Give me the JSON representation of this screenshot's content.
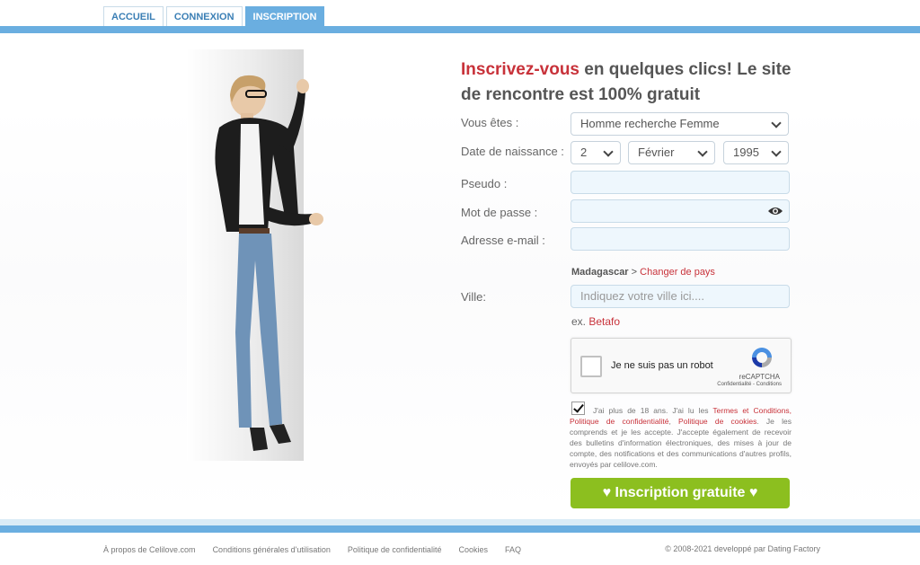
{
  "tabs": [
    {
      "label": "ACCUEIL"
    },
    {
      "label": "CONNEXION"
    },
    {
      "label": "INSCRIPTION"
    }
  ],
  "headline": {
    "accent": "Inscrivez-vous",
    "rest": " en quelques clics! Le site de rencontre est 100% gratuit"
  },
  "form": {
    "you_are_label": "Vous êtes :",
    "you_are_value": "Homme recherche Femme",
    "birth_label": "Date de naissance :",
    "birth_day": "2",
    "birth_month": "Février",
    "birth_year": "1995",
    "pseudo_label": "Pseudo :",
    "password_label": "Mot de passe :",
    "email_label": "Adresse e-mail :",
    "country": "Madagascar",
    "country_separator": ">",
    "change_country": "Changer de pays",
    "city_label": "Ville:",
    "city_placeholder": "Indiquez votre ville ici....",
    "example_prefix": "ex.",
    "example_city": "Betafo",
    "captcha_text": "Je ne suis pas un robot",
    "captcha_brand": "reCAPTCHA",
    "captcha_terms": "Confidentialité - Conditions",
    "legal_1": "J'ai plus de 18 ans. J'ai lu les ",
    "legal_link1": "Termes et Conditions, Politique de confidentialité",
    "legal_2": ", ",
    "legal_link2": "Politique de cookies",
    "legal_3": ". Je les comprends et je les accepte. J'accepte également de recevoir des bulletins d'information électroniques, des mises à jour de compte, des notifications et des communications d'autres profils, envoyés par celilove.com.",
    "submit_label": "♥ Inscription gratuite ♥"
  },
  "footer": {
    "links": [
      "À propos de Celilove.com",
      "Conditions générales d'utilisation",
      "Politique de confidentialité",
      "Cookies",
      "FAQ"
    ],
    "copyright": "© 2008-2021 developpé par Dating Factory"
  },
  "colors": {
    "accent_blue": "#6aaee0",
    "accent_red": "#c8323a",
    "submit_green": "#8cbf1f"
  },
  "icons": [
    "eye-icon",
    "recaptcha-logo-icon",
    "checkbox-check-icon"
  ]
}
